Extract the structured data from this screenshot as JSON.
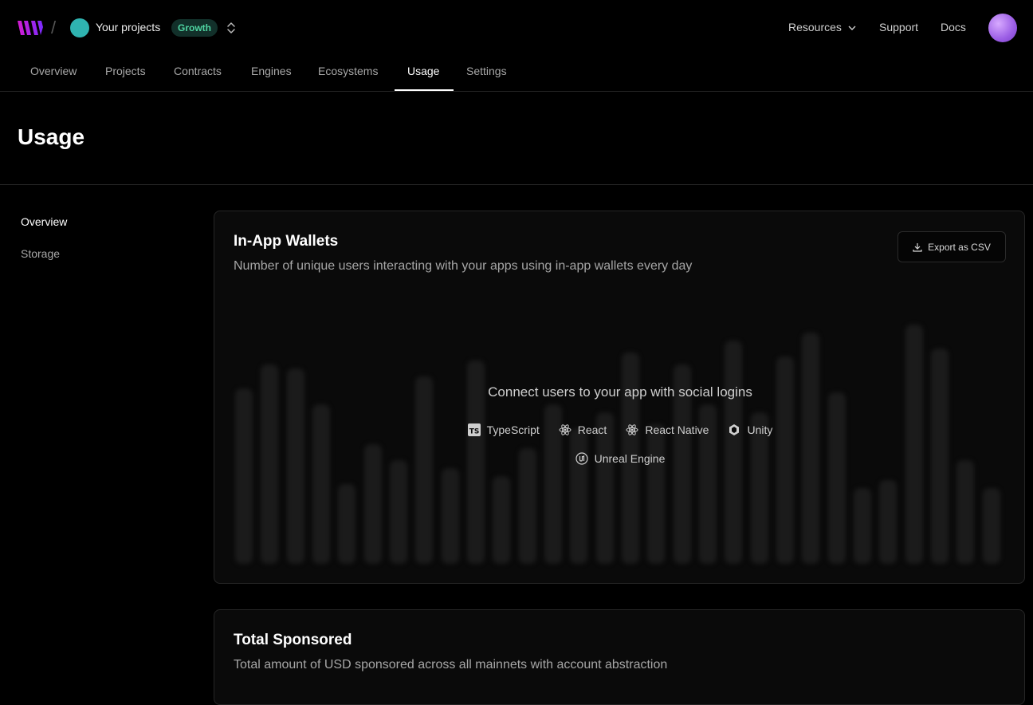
{
  "header": {
    "team_name": "Your projects",
    "plan": "Growth",
    "links": {
      "resources": "Resources",
      "support": "Support",
      "docs": "Docs"
    }
  },
  "tabs": [
    "Overview",
    "Projects",
    "Contracts",
    "Engines",
    "Ecosystems",
    "Usage",
    "Settings"
  ],
  "active_tab": "Usage",
  "page_title": "Usage",
  "sidebar": {
    "items": [
      "Overview",
      "Storage"
    ],
    "active": "Overview"
  },
  "cards": {
    "in_app_wallets": {
      "title": "In-App Wallets",
      "description": "Number of unique users interacting with your apps using in-app wallets every day",
      "export_label": "Export as CSV",
      "empty_title": "Connect users to your app with social logins",
      "sdks": [
        "TypeScript",
        "React",
        "React Native",
        "Unity",
        "Unreal Engine"
      ]
    },
    "total_sponsored": {
      "title": "Total Sponsored",
      "description": "Total amount of USD sponsored across all mainnets with account abstraction"
    }
  },
  "colors": {
    "accent_plan": "#4fd4a2",
    "team_avatar": "#2fb3b0",
    "logo_from": "#d41bd0",
    "logo_to": "#7b2cff"
  }
}
